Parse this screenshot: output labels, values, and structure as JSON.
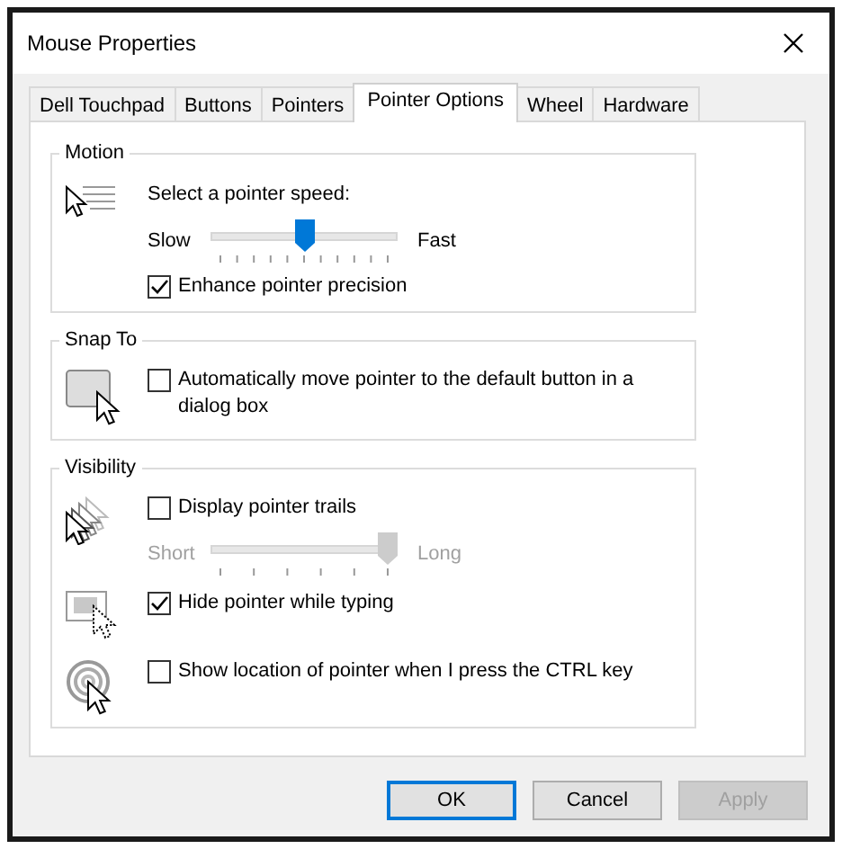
{
  "window": {
    "title": "Mouse Properties"
  },
  "tabs": [
    {
      "label": "Dell Touchpad",
      "selected": false
    },
    {
      "label": "Buttons",
      "selected": false
    },
    {
      "label": "Pointers",
      "selected": false
    },
    {
      "label": "Pointer Options",
      "selected": true
    },
    {
      "label": "Wheel",
      "selected": false
    },
    {
      "label": "Hardware",
      "selected": false
    }
  ],
  "groups": [
    {
      "title": "Motion",
      "rows": [
        {
          "controls": [
            {
              "kind": "label",
              "text": "Select a pointer speed:"
            },
            {
              "kind": "slider",
              "min_label": "Slow",
              "max_label": "Fast",
              "level": 0.5,
              "disabled": false
            },
            {
              "kind": "checkbox",
              "label": "Enhance pointer precision",
              "checked": true
            }
          ]
        }
      ]
    },
    {
      "title": "Snap To",
      "rows": [
        {
          "controls": [
            {
              "kind": "checkbox",
              "label": "Automatically move pointer to the default button in a dialog box",
              "checked": false
            }
          ]
        }
      ]
    },
    {
      "title": "Visibility",
      "rows": [
        {
          "controls": [
            {
              "kind": "checkbox",
              "label": "Display pointer trails",
              "checked": false
            },
            {
              "kind": "slider",
              "min_label": "Short",
              "max_label": "Long",
              "level": 1,
              "disabled": true
            }
          ]
        },
        {
          "controls": [
            {
              "kind": "checkbox",
              "label": "Hide pointer while typing",
              "checked": true
            }
          ]
        },
        {
          "controls": [
            {
              "kind": "checkbox",
              "label": "Show location of pointer when I press the CTRL key",
              "checked": false
            }
          ]
        }
      ]
    }
  ],
  "buttons": [
    {
      "label": "OK",
      "default": true,
      "disabled": false
    },
    {
      "label": "Cancel",
      "default": false,
      "disabled": false
    },
    {
      "label": "Apply",
      "default": false,
      "disabled": true
    }
  ]
}
